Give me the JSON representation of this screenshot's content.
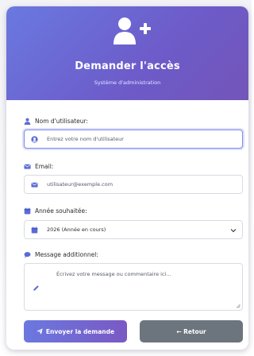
{
  "header": {
    "title": "Demander l'accès",
    "subtitle": "Système d'administration",
    "icon": "user-plus-icon"
  },
  "form": {
    "username": {
      "label": "Nom d'utilisateur:",
      "placeholder": "Entrez votre nom d'utilisateur",
      "label_icon": "user-icon",
      "field_icon": "user-circle-icon"
    },
    "email": {
      "label": "Email:",
      "placeholder": "utilisateur@exemple.com",
      "label_icon": "envelope-icon",
      "field_icon": "envelope-icon"
    },
    "year": {
      "label": "Année souhaitée:",
      "selected": "2026 (Année en cours)",
      "label_icon": "calendar-icon",
      "field_icon": "calendar-icon"
    },
    "message": {
      "label": "Message additionnel:",
      "placeholder": "Écrivez votre message ou commentaire ici...",
      "label_icon": "comment-icon",
      "field_icon": "pencil-icon"
    }
  },
  "buttons": {
    "submit": "Envoyer la demande",
    "back": "← Retour"
  },
  "colors": {
    "accent": "#6d6fd6",
    "secondary": "#6c757d",
    "icon": "#5b6bd6"
  }
}
